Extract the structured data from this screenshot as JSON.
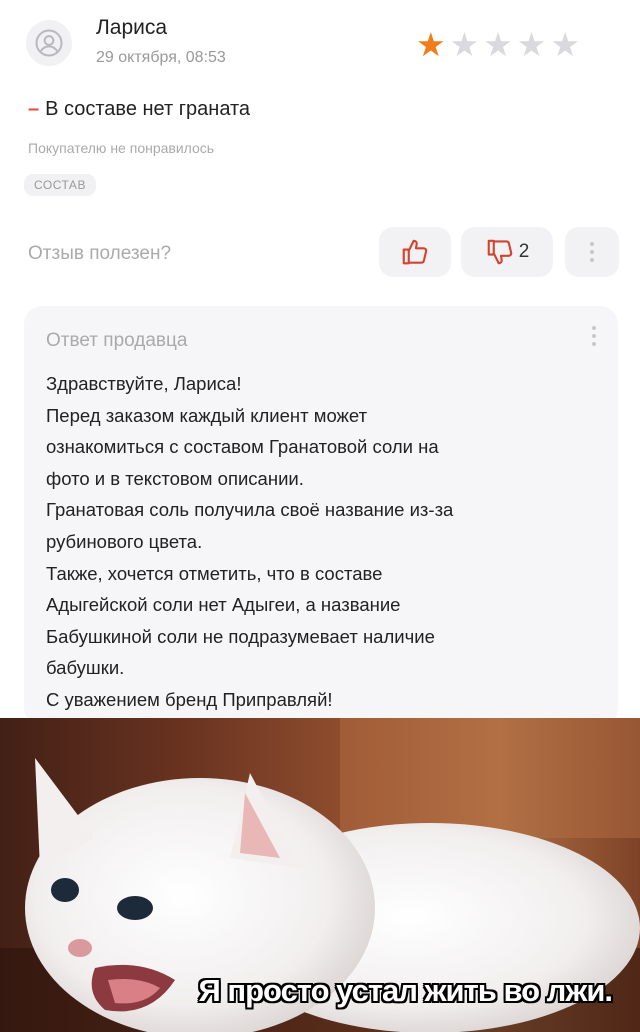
{
  "review": {
    "author": "Лариса",
    "date": "29 октября, 08:53",
    "rating": 1,
    "rating_max": 5,
    "cons_marker": "–",
    "cons_text": "В составе нет граната",
    "verdict": "Покупателю не понравилось",
    "tag": "СОСТАВ",
    "helpful_question": "Отзыв полезен?",
    "dislike_count": "2"
  },
  "seller_reply": {
    "title": "Ответ продавца",
    "lines": [
      "Здравствуйте, Лариса!",
      "Перед заказом каждый клиент может",
      "ознакомиться с составом Гранатовой соли на",
      "фото и в текстовом описании.",
      "Гранатовая соль получила своё название из-за",
      "рубинового цвета.",
      "Также, хочется отметить, что в составе",
      "Адыгейской соли нет Адыгеи, а название",
      "Бабушкиной соли не подразумевает наличие",
      "бабушки.",
      "С уважением бренд Приправляй!"
    ]
  },
  "meme": {
    "caption": "Я просто устал жить во лжи."
  },
  "colors": {
    "star_active": "#f07c1a",
    "star_inactive": "#d9d9de",
    "cons_marker": "#e8483b",
    "card_bg": "#f6f6f8"
  },
  "icons": [
    "user-icon",
    "star-icon",
    "thumbs-up-icon",
    "thumbs-down-icon",
    "more-vertical-icon"
  ]
}
